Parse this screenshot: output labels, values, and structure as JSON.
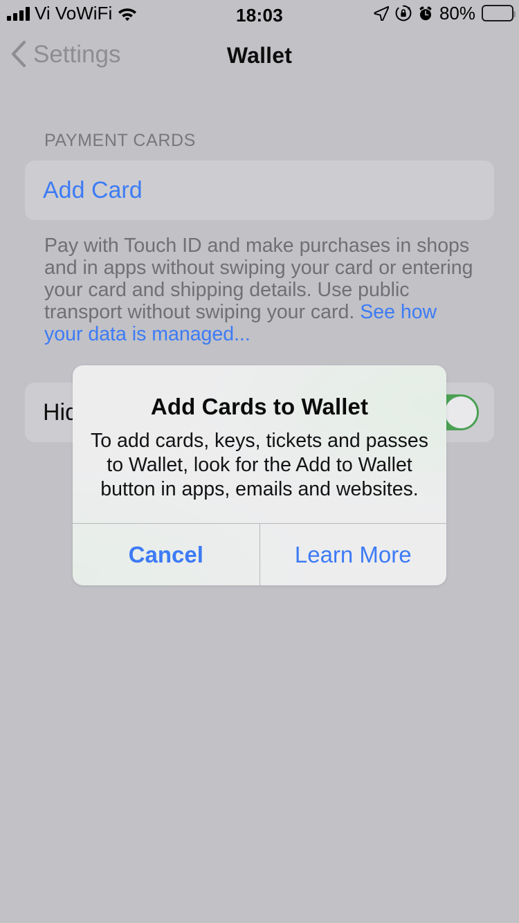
{
  "status_bar": {
    "carrier": "Vi VoWiFi",
    "time": "18:03",
    "battery_percent": "80%",
    "icons": [
      "signal-bars-icon",
      "wifi-icon",
      "location-arrow-icon",
      "rotation-lock-icon",
      "alarm-clock-icon",
      "battery-icon"
    ],
    "signal_bars": 4,
    "battery_level": 80
  },
  "nav": {
    "back_label": "Settings",
    "title": "Wallet"
  },
  "main": {
    "section_header": "PAYMENT CARDS",
    "add_card_label": "Add Card",
    "footer_text": "Pay with Touch ID and make purchases in shops and in apps without swiping your card or entering your card and shipping details. Use public transport without swiping your card. ",
    "footer_link": "See how your data is managed...",
    "hidden_row_label": "Hid",
    "hidden_row_toggle_on": true
  },
  "alert": {
    "title": "Add Cards to Wallet",
    "message": "To add cards, keys, tickets and passes to Wallet, look for the Add to Wallet button in apps, emails and websites.",
    "cancel_label": "Cancel",
    "learn_more_label": "Learn More"
  },
  "colors": {
    "accent_blue": "#3d7bf5",
    "toggle_green": "#4ba054",
    "background": "#c1c1c6",
    "cell_background": "#cdcdd1",
    "dialog_background": "#ededee",
    "secondary_text": "#77777c"
  }
}
